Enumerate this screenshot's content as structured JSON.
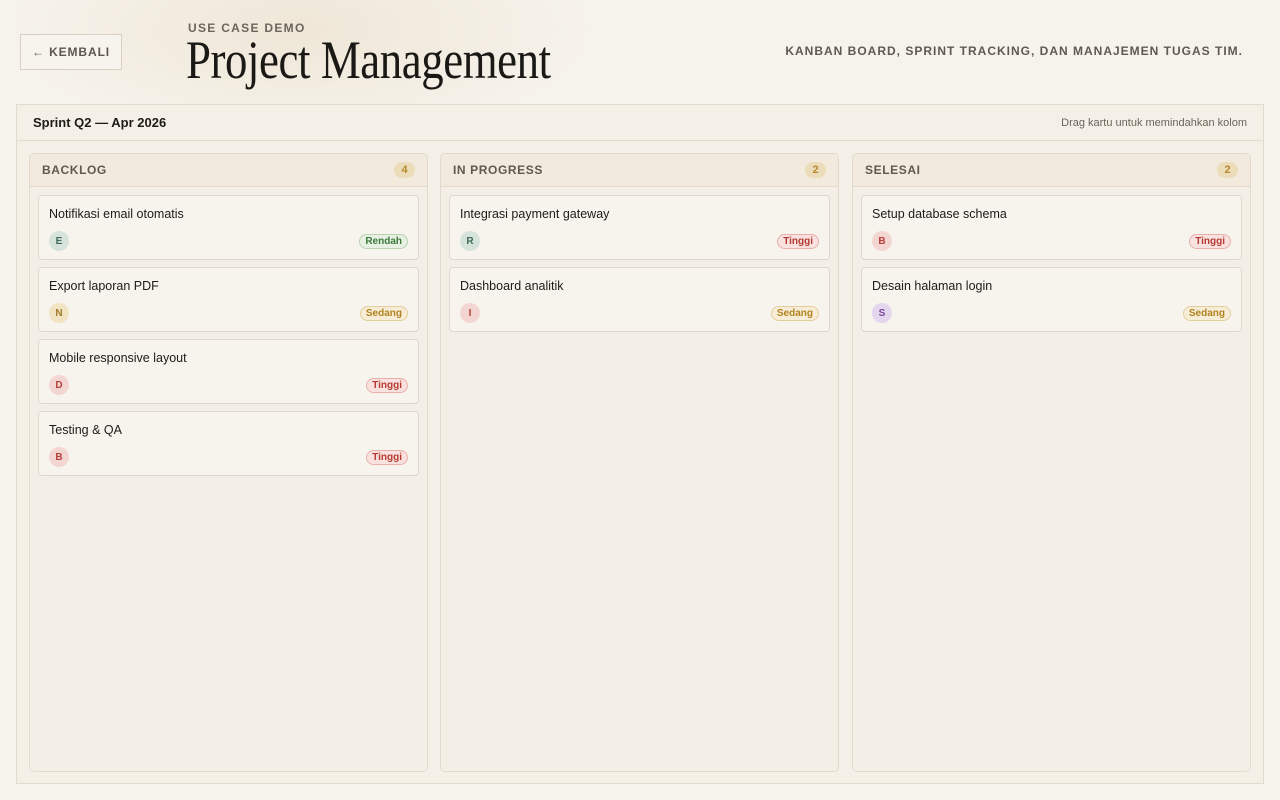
{
  "header": {
    "back_label": "← KEMBALI",
    "eyebrow": "USE CASE DEMO",
    "title": "Project Management",
    "tagline": "KANBAN BOARD, SPRINT TRACKING, DAN MANAJEMEN TUGAS TIM."
  },
  "board": {
    "sprint": "Sprint Q2 — Apr 2026",
    "hint": "Drag kartu untuk memindahkan kolom"
  },
  "colors": {
    "accent": "#b58a2c",
    "priority_low": "#3b7a3a",
    "priority_medium": "#b08320",
    "priority_high": "#b63a33"
  },
  "columns": [
    {
      "title": "BACKLOG",
      "count": "4",
      "cards": [
        {
          "title": "Notifikasi email otomatis",
          "avatar": "E",
          "priority": "Rendah"
        },
        {
          "title": "Export laporan PDF",
          "avatar": "N",
          "priority": "Sedang"
        },
        {
          "title": "Mobile responsive layout",
          "avatar": "D",
          "priority": "Tinggi"
        },
        {
          "title": "Testing & QA",
          "avatar": "B",
          "priority": "Tinggi"
        }
      ]
    },
    {
      "title": "IN PROGRESS",
      "count": "2",
      "cards": [
        {
          "title": "Integrasi payment gateway",
          "avatar": "R",
          "priority": "Tinggi"
        },
        {
          "title": "Dashboard analitik",
          "avatar": "I",
          "priority": "Sedang"
        }
      ]
    },
    {
      "title": "SELESAI",
      "count": "2",
      "cards": [
        {
          "title": "Setup database schema",
          "avatar": "B",
          "priority": "Tinggi"
        },
        {
          "title": "Desain halaman login",
          "avatar": "S",
          "priority": "Sedang"
        }
      ]
    }
  ]
}
